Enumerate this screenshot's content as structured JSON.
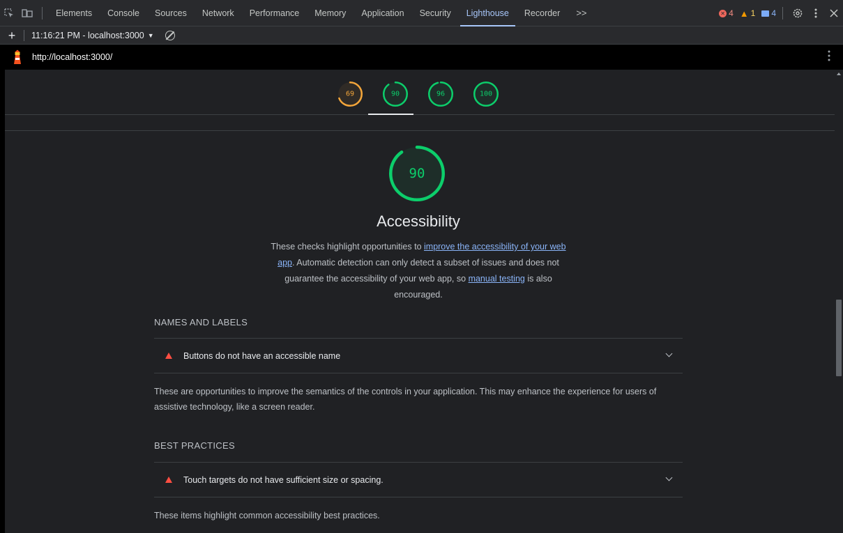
{
  "tabbar": {
    "tabs": [
      "Elements",
      "Console",
      "Sources",
      "Network",
      "Performance",
      "Memory",
      "Application",
      "Security",
      "Lighthouse",
      "Recorder"
    ],
    "active_tab": "Lighthouse",
    "more_label": ">>",
    "errors": "4",
    "warnings": "1",
    "infos": "4"
  },
  "toolbar": {
    "report_label": "11:16:21 PM - localhost:3000"
  },
  "urlbar": {
    "url": "http://localhost:3000/"
  },
  "scores": {
    "gauges": [
      {
        "score": 69,
        "label": "69",
        "color": "#f4a63a"
      },
      {
        "score": 90,
        "label": "90",
        "color": "#0cce6b"
      },
      {
        "score": 96,
        "label": "96",
        "color": "#0cce6b"
      },
      {
        "score": 100,
        "label": "100",
        "color": "#0cce6b"
      }
    ],
    "active_index": 1
  },
  "category": {
    "score": 90,
    "score_label": "90",
    "title": "Accessibility",
    "desc_part1": "These checks highlight opportunities to ",
    "desc_link1": "improve the accessibility of your web app",
    "desc_part2": ". Automatic detection can only detect a subset of issues and does not guarantee the accessibility of your web app, so ",
    "desc_link2": "manual testing",
    "desc_part3": " is also encouraged."
  },
  "groups": [
    {
      "title": "NAMES AND LABELS",
      "audit": "Buttons do not have an accessible name",
      "description": "These are opportunities to improve the semantics of the controls in your application. This may enhance the experience for users of assistive technology, like a screen reader."
    },
    {
      "title": "BEST PRACTICES",
      "audit": "Touch targets do not have sufficient size or spacing.",
      "description": "These items highlight common accessibility best practices."
    }
  ],
  "colors": {
    "pass": "#0cce6b",
    "average": "#f4a63a",
    "fail": "#ff4e42",
    "link": "#8ab4f8"
  }
}
